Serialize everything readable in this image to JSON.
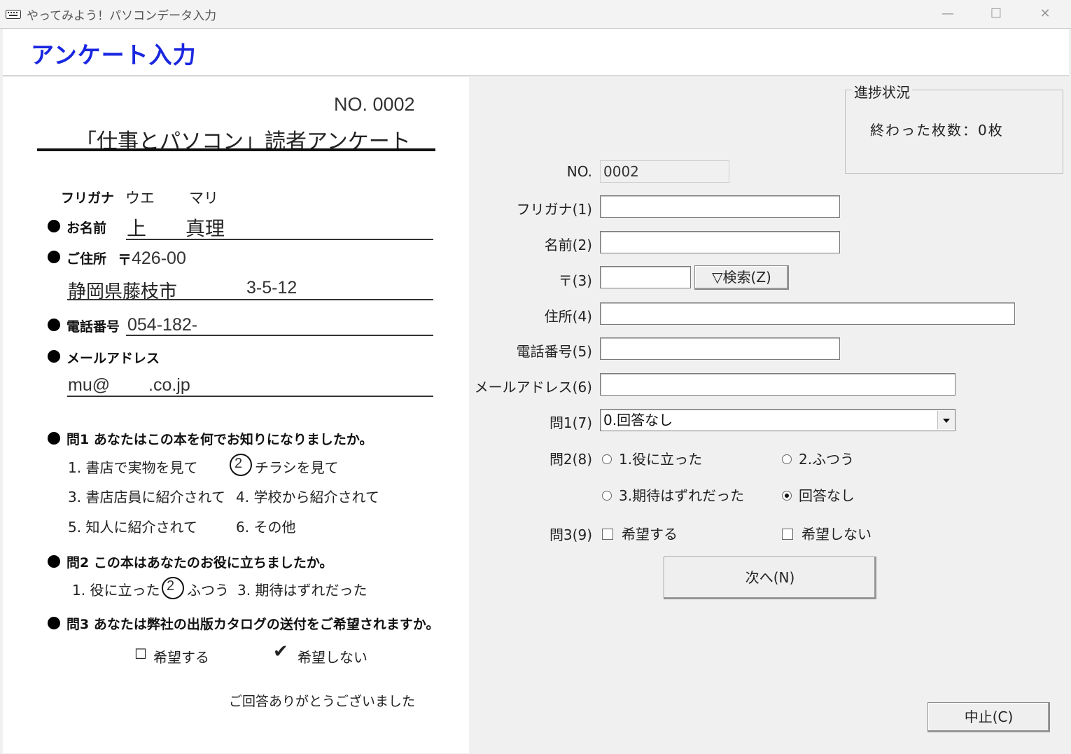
{
  "window": {
    "title": "やってみよう！パソコンデータ入力",
    "minimize": "—",
    "maximize": "☐",
    "close": "✕"
  },
  "header": {
    "title": "アンケート入力"
  },
  "paper": {
    "no": "NO. 0002",
    "title": "「仕事とパソコン」読者アンケート",
    "furigana_label": "フリガナ",
    "furigana_last": "ウエ",
    "furigana_first": "マリ",
    "name_label": "お名前",
    "name_last": "上",
    "name_first": "真理",
    "address_label": "ご住所",
    "postal_mark": "〒",
    "postal": "426-00",
    "address_city": "静岡県藤枝市",
    "address_rest": "3-5-12",
    "phone_label": "電話番号",
    "phone": "054-182-",
    "email_label": "メールアドレス",
    "email_user": "mu@",
    "email_domain": ".co.jp",
    "q1": "問1 あなたはこの本を何でお知りになりましたか。",
    "q1_opt1": "1. 書店で実物を見て",
    "q1_opt2_num": "2",
    "q1_opt2": "チラシを見て",
    "q1_opt3": "3. 書店店員に紹介されて",
    "q1_opt4": "4. 学校から紹介されて",
    "q1_opt5": "5. 知人に紹介されて",
    "q1_opt6": "6. その他",
    "q2": "問2 この本はあなたのお役に立ちましたか。",
    "q2_opt1": "1. 役に立った",
    "q2_opt2_num": "2",
    "q2_opt2": "ふつう",
    "q2_opt3": "3. 期待はずれだった",
    "q3": "問3 あなたは弊社の出版カタログの送付をご希望されますか。",
    "q3_box": "☐",
    "q3_opt1": "希望する",
    "q3_check": "✔",
    "q3_opt2": "希望しない",
    "thanks": "ご回答ありがとうございました"
  },
  "form": {
    "no_label": "NO.",
    "no_value": "0002",
    "furigana_label": "フリガナ(1)",
    "furigana_value": "",
    "name_label": "名前(2)",
    "name_value": "",
    "postal_label": "〒(3)",
    "postal_value": "",
    "search_button": "▽検索(Z)",
    "address_label": "住所(4)",
    "address_value": "",
    "phone_label": "電話番号(5)",
    "phone_value": "",
    "email_label": "メールアドレス(6)",
    "email_value": "",
    "q1_label": "問1(7)",
    "q1_value": "0.回答なし",
    "q2_label": "問2(8)",
    "q2_options": [
      "1.役に立った",
      "2.ふつう",
      "3.期待はずれだった",
      "回答なし"
    ],
    "q2_selected": 3,
    "q3_label": "問3(9)",
    "q3_options": [
      "希望する",
      "希望しない"
    ],
    "next_button": "次へ(N)",
    "cancel_button": "中止(C)"
  },
  "progress": {
    "legend": "進捗状況",
    "text": "終わった枚数：0枚"
  }
}
